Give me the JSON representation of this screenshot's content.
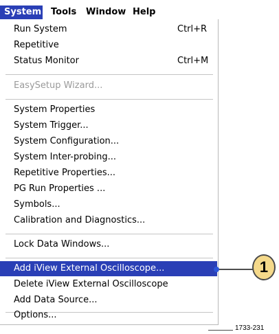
{
  "menubar": {
    "items": [
      "System",
      "Tools",
      "Window",
      "Help"
    ]
  },
  "menu": {
    "items": [
      {
        "label": "Run System",
        "shortcut": "Ctrl+R"
      },
      {
        "label": "Repetitive"
      },
      {
        "label": "Status Monitor",
        "shortcut": "Ctrl+M"
      },
      {
        "label": "EasySetup Wizard...",
        "state": "disabled"
      },
      {
        "label": "System Properties"
      },
      {
        "label": "System Trigger..."
      },
      {
        "label": "System Configuration..."
      },
      {
        "label": "System Inter-probing..."
      },
      {
        "label": "Repetitive Properties..."
      },
      {
        "label": "PG Run Properties ..."
      },
      {
        "label": "Symbols..."
      },
      {
        "label": "Calibration and Diagnostics..."
      },
      {
        "label": "Lock Data Windows..."
      },
      {
        "label": "Add iView External Oscilloscope...",
        "state": "highlighted"
      },
      {
        "label": "Delete iView External Oscilloscope"
      },
      {
        "label": "Add Data Source..."
      },
      {
        "label": "Options..."
      }
    ]
  },
  "callout": {
    "number": "1"
  },
  "figure_ref": "1733-231",
  "colors": {
    "highlight": "#2a3fb6",
    "callout_fill": "#f5d98a",
    "disabled_text": "#9a9a9a"
  }
}
